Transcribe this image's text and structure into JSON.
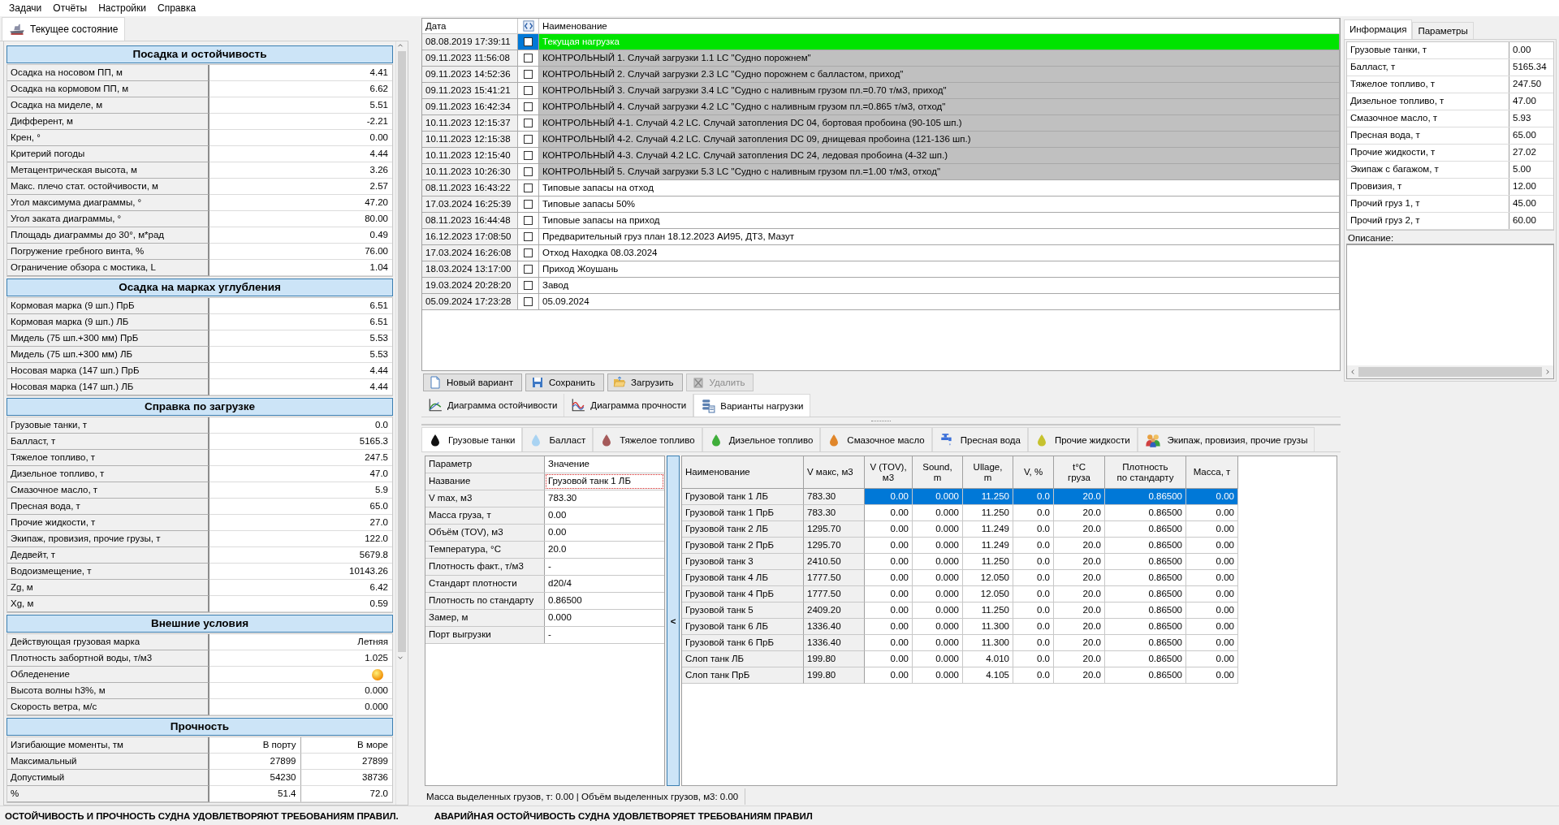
{
  "menu": [
    "Задачи",
    "Отчёты",
    "Настройки",
    "Справка"
  ],
  "left_panel": {
    "tab": "Текущее состояние",
    "sections": [
      {
        "title": "Посадка и остойчивость",
        "rows": [
          {
            "label": "Осадка на носовом ПП, м",
            "values": [
              "4.41"
            ]
          },
          {
            "label": "Осадка на кормовом ПП, м",
            "values": [
              "6.62"
            ]
          },
          {
            "label": "Осадка на миделе, м",
            "values": [
              "5.51"
            ]
          },
          {
            "label": "Дифферент, м",
            "values": [
              "-2.21"
            ]
          },
          {
            "label": "Крен, °",
            "values": [
              "0.00"
            ]
          },
          {
            "label": "Критерий погоды",
            "values": [
              "4.44"
            ]
          },
          {
            "label": "Метацентрическая высота, м",
            "values": [
              "3.26"
            ]
          },
          {
            "label": "Макс. плечо стат. остойчивости, м",
            "values": [
              "2.57"
            ]
          },
          {
            "label": "Угол максимума диаграммы, °",
            "values": [
              "47.20"
            ]
          },
          {
            "label": "Угол заката диаграммы,  °",
            "values": [
              "80.00"
            ]
          },
          {
            "label": "Площадь диаграммы до 30°, м*рад",
            "values": [
              "0.49"
            ]
          },
          {
            "label": "Погружение гребного винта, %",
            "values": [
              "76.00"
            ]
          },
          {
            "label": "Ограничение обзора с мостика, L",
            "values": [
              "1.04"
            ]
          }
        ]
      },
      {
        "title": "Осадка на марках углубления",
        "rows": [
          {
            "label": "Кормовая марка (9 шп.) ПрБ",
            "values": [
              "6.51"
            ]
          },
          {
            "label": "Кормовая марка (9 шп.) ЛБ",
            "values": [
              "6.51"
            ]
          },
          {
            "label": "Мидель (75 шп.+300 мм) ПрБ",
            "values": [
              "5.53"
            ]
          },
          {
            "label": "Мидель (75 шп.+300 мм) ЛБ",
            "values": [
              "5.53"
            ]
          },
          {
            "label": "Носовая марка (147 шп.) ПрБ",
            "values": [
              "4.44"
            ]
          },
          {
            "label": "Носовая марка (147 шп.) ЛБ",
            "values": [
              "4.44"
            ]
          }
        ]
      },
      {
        "title": "Справка по загрузке",
        "rows": [
          {
            "label": "Грузовые танки, т",
            "values": [
              "0.0"
            ]
          },
          {
            "label": "Балласт, т",
            "values": [
              "5165.3"
            ]
          },
          {
            "label": "Тяжелое топливо, т",
            "values": [
              "247.5"
            ]
          },
          {
            "label": "Дизельное топливо, т",
            "values": [
              "47.0"
            ]
          },
          {
            "label": "Смазочное масло, т",
            "values": [
              "5.9"
            ]
          },
          {
            "label": "Пресная вода, т",
            "values": [
              "65.0"
            ]
          },
          {
            "label": "Прочие жидкости, т",
            "values": [
              "27.0"
            ]
          },
          {
            "label": "Экипаж, провизия, прочие грузы, т",
            "values": [
              "122.0"
            ]
          },
          {
            "label": "Дедвейт, т",
            "values": [
              "5679.8"
            ]
          },
          {
            "label": "Водоизмещение, т",
            "values": [
              "10143.26"
            ]
          },
          {
            "label": "Zg, м",
            "values": [
              "6.42"
            ]
          },
          {
            "label": "Xg, м",
            "values": [
              "0.59"
            ]
          }
        ]
      },
      {
        "title": "Внешние условия",
        "rows": [
          {
            "label": "Действующая грузовая марка",
            "kind": "text",
            "values": [
              "Летняя"
            ]
          },
          {
            "label": "Плотность забортной воды, т/м3",
            "kind": "text",
            "values": [
              "1.025"
            ]
          },
          {
            "label": "Обледенение",
            "kind": "icon"
          },
          {
            "label": "Высота волны h3%, м",
            "kind": "text",
            "values": [
              "0.000"
            ]
          },
          {
            "label": "Скорость ветра, м/с",
            "kind": "text",
            "values": [
              "0.000"
            ]
          }
        ]
      },
      {
        "title": "Прочность",
        "rows": [
          {
            "label": "Изгибающие моменты, тм",
            "values": [
              "В порту",
              "В море"
            ]
          },
          {
            "label": "Максимальный",
            "values": [
              "27899",
              "27899"
            ]
          },
          {
            "label": "Допустимый",
            "values": [
              "54230",
              "38736"
            ]
          },
          {
            "label": "%",
            "values": [
              "51.4",
              "72.0"
            ]
          }
        ]
      }
    ]
  },
  "load_variants": {
    "columns": [
      "Дата",
      "Наименование"
    ],
    "rows": [
      {
        "date": "08.08.2019 17:39:11",
        "checked": false,
        "selected": true,
        "kind": "current",
        "name": "Текущая нагрузка"
      },
      {
        "date": "09.11.2023 11:56:08",
        "checked": false,
        "selected": false,
        "kind": "control",
        "name": "КОНТРОЛЬНЫЙ 1. Случай загрузки 1.1 LC \"Судно порожнем\""
      },
      {
        "date": "09.11.2023 14:52:36",
        "checked": false,
        "selected": false,
        "kind": "control",
        "name": "КОНТРОЛЬНЫЙ 2. Случай загрузки 2.3 LC \"Судно порожнем с балластом, приход\""
      },
      {
        "date": "09.11.2023 15:41:21",
        "checked": false,
        "selected": false,
        "kind": "control",
        "name": "КОНТРОЛЬНЫЙ 3. Случай загрузки 3.4 LC \"Судно с наливным грузом пл.=0.70 т/м3, приход\""
      },
      {
        "date": "09.11.2023 16:42:34",
        "checked": false,
        "selected": false,
        "kind": "control",
        "name": "КОНТРОЛЬНЫЙ 4. Случай загрузки 4.2 LC \"Судно с наливным грузом пл.=0.865 т/м3, отход\""
      },
      {
        "date": "10.11.2023 12:15:37",
        "checked": false,
        "selected": false,
        "kind": "control",
        "name": "КОНТРОЛЬНЫЙ 4-1. Случай 4.2 LC. Случай затопления DC 04, бортовая пробоина (90-105 шп.)"
      },
      {
        "date": "10.11.2023 12:15:38",
        "checked": false,
        "selected": false,
        "kind": "control",
        "name": "КОНТРОЛЬНЫЙ 4-2. Случай 4.2 LC. Случай затопления DC 09, днищевая пробоина (121-136 шп.)"
      },
      {
        "date": "10.11.2023 12:15:40",
        "checked": false,
        "selected": false,
        "kind": "control",
        "name": "КОНТРОЛЬНЫЙ 4-3. Случай 4.2 LC. Случай затопления DC 24, ледовая пробоина (4-32 шп.)"
      },
      {
        "date": "10.11.2023 10:26:30",
        "checked": false,
        "selected": false,
        "kind": "control",
        "name": "КОНТРОЛЬНЫЙ 5. Случай загрузки 5.3 LC \"Судно с наливным грузом пл.=1.00 т/м3, отход\""
      },
      {
        "date": "08.11.2023 16:43:22",
        "checked": false,
        "selected": false,
        "kind": "normal",
        "name": "Типовые запасы на отход"
      },
      {
        "date": "17.03.2024 16:25:39",
        "checked": false,
        "selected": false,
        "kind": "normal",
        "name": "Типовые запасы 50%"
      },
      {
        "date": "08.11.2023 16:44:48",
        "checked": false,
        "selected": false,
        "kind": "normal",
        "name": "Типовые запасы на приход"
      },
      {
        "date": "16.12.2023 17:08:50",
        "checked": false,
        "selected": false,
        "kind": "normal",
        "name": "Предварительный груз план 18.12.2023 АИ95, ДТ3, Мазут"
      },
      {
        "date": "17.03.2024 16:26:08",
        "checked": false,
        "selected": false,
        "kind": "normal",
        "name": "Отход Находка 08.03.2024"
      },
      {
        "date": "18.03.2024 13:17:00",
        "checked": false,
        "selected": false,
        "kind": "normal",
        "name": "Приход Жоушань"
      },
      {
        "date": "19.03.2024 20:28:20",
        "checked": false,
        "selected": false,
        "kind": "normal",
        "name": "Завод"
      },
      {
        "date": "05.09.2024 17:23:28",
        "checked": false,
        "selected": false,
        "kind": "normal",
        "name": "05.09.2024"
      }
    ]
  },
  "buttons": [
    {
      "label": "Новый вариант",
      "kind": "new",
      "disabled": false
    },
    {
      "label": "Сохранить",
      "kind": "save",
      "disabled": false
    },
    {
      "label": "Загрузить",
      "kind": "load",
      "disabled": false
    },
    {
      "label": "Удалить",
      "kind": "delete",
      "disabled": true
    }
  ],
  "view_tabs": [
    {
      "label": "Диаграмма остойчивости",
      "kind": "stability",
      "selected": false
    },
    {
      "label": "Диаграмма прочности",
      "kind": "strength",
      "selected": false
    },
    {
      "label": "Варианты нагрузки",
      "kind": "variants",
      "selected": true
    }
  ],
  "info_panel": {
    "tabs": [
      {
        "label": "Информация",
        "selected": true
      },
      {
        "label": "Параметры",
        "selected": false
      }
    ],
    "rows": [
      {
        "label": "Грузовые танки, т",
        "value": "0.00"
      },
      {
        "label": "Балласт, т",
        "value": "5165.34"
      },
      {
        "label": "Тяжелое топливо, т",
        "value": "247.50"
      },
      {
        "label": "Дизельное топливо, т",
        "value": "47.00"
      },
      {
        "label": "Смазочное масло, т",
        "value": "5.93"
      },
      {
        "label": "Пресная вода, т",
        "value": "65.00"
      },
      {
        "label": "Прочие жидкости, т",
        "value": "27.02"
      },
      {
        "label": "Экипаж с багажом, т",
        "value": "5.00"
      },
      {
        "label": "Провизия, т",
        "value": "12.00"
      },
      {
        "label": "Прочий груз 1, т",
        "value": "45.00"
      },
      {
        "label": "Прочий груз 2, т",
        "value": "60.00"
      }
    ],
    "description_label": "Описание:"
  },
  "cargo_tabs": [
    {
      "label": "Грузовые танки",
      "kind": "drop",
      "color": "#111111",
      "selected": true
    },
    {
      "label": "Балласт",
      "kind": "drop",
      "color": "#a9d3f2",
      "selected": false
    },
    {
      "label": "Тяжелое топливо",
      "kind": "drop",
      "color": "#a55a5a",
      "selected": false
    },
    {
      "label": "Дизельное топливо",
      "kind": "drop",
      "color": "#3fae3a",
      "selected": false
    },
    {
      "label": "Смазочное масло",
      "kind": "drop",
      "color": "#e0862a",
      "selected": false
    },
    {
      "label": "Пресная вода",
      "kind": "tap",
      "selected": false
    },
    {
      "label": "Прочие жидкости",
      "kind": "drop",
      "color": "#c6c22e",
      "selected": false
    },
    {
      "label": "Экипаж, провизия, прочие грузы",
      "kind": "people",
      "selected": false
    }
  ],
  "parameters": {
    "columns": [
      "Параметр",
      "Значение"
    ],
    "rows": [
      {
        "label": "Название",
        "value": "Грузовой танк 1 ЛБ",
        "selected": true
      },
      {
        "label": "V max, м3",
        "value": "783.30",
        "selected": false
      },
      {
        "label": "Масса груза, т",
        "value": "0.00",
        "selected": false
      },
      {
        "label": "Объём (TOV), м3",
        "value": "0.00",
        "selected": false
      },
      {
        "label": "Температура, °C",
        "value": "20.0",
        "selected": false
      },
      {
        "label": "Плотность факт., т/м3",
        "value": "-",
        "selected": false
      },
      {
        "label": "Стандарт плотности",
        "value": "d20/4",
        "selected": false
      },
      {
        "label": "Плотность по стандарту",
        "value": "0.86500",
        "selected": false
      },
      {
        "label": "Замер, м",
        "value": "0.000",
        "selected": false
      },
      {
        "label": "Порт выгрузки",
        "value": "-",
        "selected": false
      }
    ]
  },
  "collapse_button": "<",
  "tanks": {
    "columns": [
      "Наименование",
      "V макс, м3",
      "V (TOV),\nм3",
      "Sound,\nm",
      "Ullage,\nm",
      "V, %",
      "t°C\nгруза",
      "Плотность\nпо стандарту",
      "Масса, т"
    ],
    "rows": [
      {
        "selected": true,
        "cells": [
          "Грузовой танк 1 ЛБ",
          "783.30",
          "0.00",
          "0.000",
          "11.250",
          "0.0",
          "20.0",
          "0.86500",
          "0.00"
        ]
      },
      {
        "selected": false,
        "cells": [
          "Грузовой танк 1 ПрБ",
          "783.30",
          "0.00",
          "0.000",
          "11.250",
          "0.0",
          "20.0",
          "0.86500",
          "0.00"
        ]
      },
      {
        "selected": false,
        "cells": [
          "Грузовой танк 2 ЛБ",
          "1295.70",
          "0.00",
          "0.000",
          "11.249",
          "0.0",
          "20.0",
          "0.86500",
          "0.00"
        ]
      },
      {
        "selected": false,
        "cells": [
          "Грузовой танк 2 ПрБ",
          "1295.70",
          "0.00",
          "0.000",
          "11.249",
          "0.0",
          "20.0",
          "0.86500",
          "0.00"
        ]
      },
      {
        "selected": false,
        "cells": [
          "Грузовой танк 3",
          "2410.50",
          "0.00",
          "0.000",
          "11.250",
          "0.0",
          "20.0",
          "0.86500",
          "0.00"
        ]
      },
      {
        "selected": false,
        "cells": [
          "Грузовой танк 4 ЛБ",
          "1777.50",
          "0.00",
          "0.000",
          "12.050",
          "0.0",
          "20.0",
          "0.86500",
          "0.00"
        ]
      },
      {
        "selected": false,
        "cells": [
          "Грузовой танк 4 ПрБ",
          "1777.50",
          "0.00",
          "0.000",
          "12.050",
          "0.0",
          "20.0",
          "0.86500",
          "0.00"
        ]
      },
      {
        "selected": false,
        "cells": [
          "Грузовой танк 5",
          "2409.20",
          "0.00",
          "0.000",
          "11.250",
          "0.0",
          "20.0",
          "0.86500",
          "0.00"
        ]
      },
      {
        "selected": false,
        "cells": [
          "Грузовой танк 6 ЛБ",
          "1336.40",
          "0.00",
          "0.000",
          "11.300",
          "0.0",
          "20.0",
          "0.86500",
          "0.00"
        ]
      },
      {
        "selected": false,
        "cells": [
          "Грузовой танк 6 ПрБ",
          "1336.40",
          "0.00",
          "0.000",
          "11.300",
          "0.0",
          "20.0",
          "0.86500",
          "0.00"
        ]
      },
      {
        "selected": false,
        "cells": [
          "Слоп танк ЛБ",
          "199.80",
          "0.00",
          "0.000",
          "4.010",
          "0.0",
          "20.0",
          "0.86500",
          "0.00"
        ]
      },
      {
        "selected": false,
        "cells": [
          "Слоп танк ПрБ",
          "199.80",
          "0.00",
          "0.000",
          "4.105",
          "0.0",
          "20.0",
          "0.86500",
          "0.00"
        ]
      }
    ]
  },
  "selection_summary": "Масса выделенных грузов, т: 0.00 | Объём выделенных грузов, м3: 0.00",
  "status_bar": [
    "ОСТОЙЧИВОСТЬ И ПРОЧНОСТЬ СУДНА УДОВЛЕТВОРЯЮТ ТРЕБОВАНИЯМ ПРАВИЛ.",
    "АВАРИЙНАЯ ОСТОЙЧИВОСТЬ СУДНА УДОВЛЕТВОРЯЕТ ТРЕБОВАНИЯМ ПРАВИЛ"
  ]
}
